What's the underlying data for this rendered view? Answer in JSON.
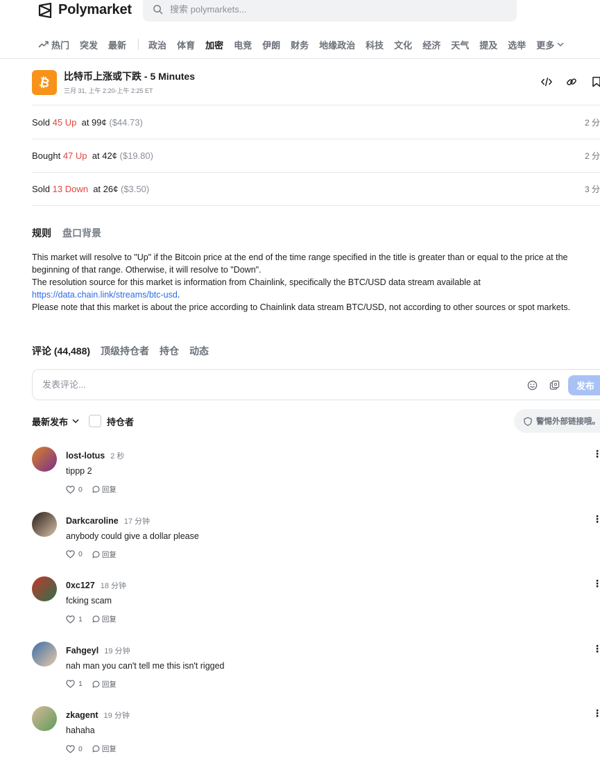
{
  "header": {
    "brand": "Polymarket",
    "search_placeholder": "搜索 polymarkets..."
  },
  "categories": {
    "items": [
      "热门",
      "突发",
      "最新",
      "政治",
      "体育",
      "加密",
      "电竞",
      "伊朗",
      "财务",
      "地缘政治",
      "科技",
      "文化",
      "经济",
      "天气",
      "提及",
      "选举"
    ],
    "active": "加密",
    "more_label": "更多"
  },
  "market": {
    "title": "比特币上涨或下跌 - 5 Minutes",
    "time": "三月 31, 上午 2:20-上午 2:25 ET"
  },
  "activity": [
    {
      "action": "Sold",
      "shares": "45 Up",
      "price": "at 99¢",
      "usd": "($44.73)",
      "ago": "2 分"
    },
    {
      "action": "Bought",
      "shares": "47 Up",
      "price": "at 42¢",
      "usd": "($19.80)",
      "ago": "2 分"
    },
    {
      "action": "Sold",
      "shares": "13 Down",
      "price": "at 26¢",
      "usd": "($3.50)",
      "ago": "3 分"
    }
  ],
  "rules": {
    "tabs": [
      "规则",
      "盘口背景"
    ],
    "line1": "This market will resolve to \"Up\" if the Bitcoin price at the end of the time range specified in the title is greater than or equal to the price at the",
    "line2": "beginning of that range. Otherwise, it will resolve to \"Down\".",
    "line3": "The resolution source for this market is information from Chainlink, specifically the BTC/USD data stream available at",
    "link": "https://data.chain.link/streams/btc-usd",
    "link_suffix": ".",
    "line5": "Please note that this market is about the price according to Chainlink data stream BTC/USD, not according to other sources or spot markets."
  },
  "comments_section": {
    "tabs": [
      "评论 (44,488)",
      "顶级持仓者",
      "持仓",
      "动态"
    ],
    "input_placeholder": "发表评论...",
    "post_label": "发布",
    "sort_label": "最新发布",
    "holders_label": "持仓者",
    "warning": "警惕外部链接哦。",
    "reply_label": "回复",
    "items": [
      {
        "user": "lost-lotus",
        "time": "2 秒",
        "text": "tippp 2",
        "likes": "0",
        "avatar_colors": [
          "#d9822b",
          "#7a2f8a"
        ]
      },
      {
        "user": "Darkcaroline",
        "time": "17 分钟",
        "text": "anybody could give a dollar please",
        "likes": "0",
        "avatar_colors": [
          "#2a1d1a",
          "#d8c2a8"
        ]
      },
      {
        "user": "0xc127",
        "time": "18 分钟",
        "text": "fcking scam",
        "likes": "1",
        "avatar_colors": [
          "#c0392b",
          "#2f6f4e"
        ]
      },
      {
        "user": "Fahgeyl",
        "time": "19 分钟",
        "text": "nah man you can't tell me this isn't rigged",
        "likes": "1",
        "avatar_colors": [
          "#3b6ea8",
          "#e8c9a8"
        ]
      },
      {
        "user": "zkagent",
        "time": "19 分钟",
        "text": "hahaha",
        "likes": "0",
        "avatar_colors": [
          "#d7b89a",
          "#5e9c5a"
        ]
      }
    ]
  }
}
